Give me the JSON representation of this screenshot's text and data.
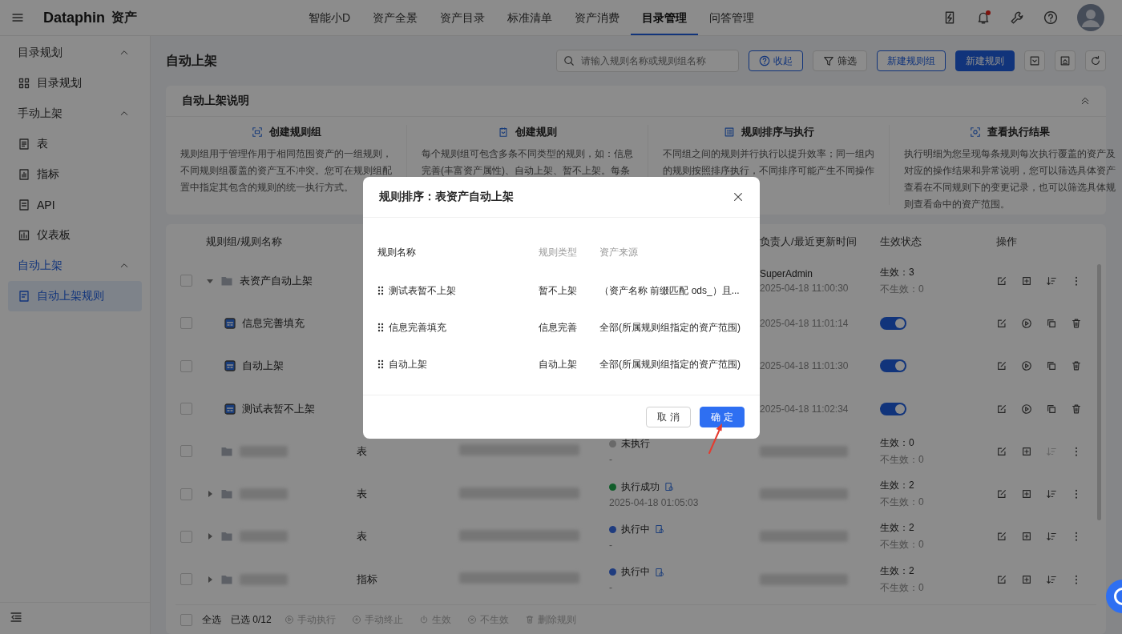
{
  "topbar": {
    "logo": "Dataphin",
    "product": "资产",
    "notification_dot": true,
    "nav": [
      {
        "label": "智能小D",
        "selected": false
      },
      {
        "label": "资产全景",
        "selected": false
      },
      {
        "label": "资产目录",
        "selected": false
      },
      {
        "label": "标准清单",
        "selected": false
      },
      {
        "label": "资产消费",
        "selected": false
      },
      {
        "label": "目录管理",
        "selected": true
      },
      {
        "label": "问答管理",
        "selected": false
      }
    ]
  },
  "sidebar": {
    "sections": [
      {
        "title": "目录规划",
        "expanded": true,
        "items": [
          {
            "label": "目录规划",
            "selected": false
          }
        ]
      },
      {
        "title": "手动上架",
        "expanded": true,
        "items": [
          {
            "label": "表",
            "selected": false
          },
          {
            "label": "指标",
            "selected": false
          },
          {
            "label": "API",
            "selected": false
          },
          {
            "label": "仪表板",
            "selected": false
          }
        ]
      },
      {
        "title": "自动上架",
        "expanded": true,
        "items": [
          {
            "label": "自动上架规则",
            "selected": true
          }
        ]
      }
    ]
  },
  "page": {
    "title": "自动上架",
    "search": {
      "placeholder": "请输入规则名称或规则组名称"
    },
    "buttons": [
      {
        "label": "收起",
        "kind": "collapse"
      },
      {
        "label": "筛选",
        "kind": "filter"
      },
      {
        "label": "新建规则组",
        "kind": "outline"
      },
      {
        "label": "新建规则",
        "kind": "primary"
      }
    ]
  },
  "intro": {
    "title": "自动上架说明",
    "expanded": true,
    "cards": [
      {
        "title": "创建规则组",
        "lines": [
          "规则组用于管理作用于相同范围资产的一组规则，",
          "不同规则组覆盖的资产互不冲突。您可在规则组配",
          "置中指定其包含的规则的统一执行方式。"
        ]
      },
      {
        "title": "创建规则",
        "lines": [
          "每个规则组可包含多条不同类型的规则，如：信息",
          "完善(丰富资产属性)、自动上架、暂不上架。每条"
        ]
      },
      {
        "title": "规则排序与执行",
        "lines": [
          "不同组之间的规则并行执行以提升效率；同一组内",
          "的规则按照排序执行，不同排序可能产生不同操作"
        ]
      },
      {
        "title": "查看执行结果",
        "lines": [
          "执行明细为您呈现每条规则每次执行覆盖的资产及",
          "对应的操作结果和异常说明，您可以筛选具体资产",
          "查看在不同规则下的变更记录，也可以筛选具体规",
          "则查看命中的资产范围。"
        ]
      }
    ]
  },
  "table": {
    "columns": {
      "name": "规则组/规则名称",
      "owner": "负责人/最近更新时间",
      "state": "生效状态",
      "actions": "操作"
    },
    "rows": [
      {
        "kind": "group",
        "checked": false,
        "expanded": true,
        "name": "表资产自动上架",
        "owner": "SuperAdmin",
        "time": "2025-04-18 11:00:30",
        "effective": "生效：3",
        "ineffective": "不生效：0",
        "sort_disabled": false
      },
      {
        "kind": "rule",
        "checked": false,
        "name": "信息完善填充",
        "time": "2025-04-18 11:01:14",
        "on": true
      },
      {
        "kind": "rule",
        "checked": false,
        "name": "自动上架",
        "time": "2025-04-18 11:01:30",
        "on": true
      },
      {
        "kind": "rule",
        "checked": false,
        "name": "测试表暂不上架",
        "time": "2025-04-18 11:02:34",
        "on": true
      },
      {
        "kind": "group",
        "checked": false,
        "type": "表",
        "status": {
          "kind": "idle",
          "label": "未执行",
          "time": "-"
        },
        "effective": "生效：0",
        "ineffective": "不生效：0",
        "sort_disabled": true
      },
      {
        "kind": "group",
        "checked": false,
        "expanded": false,
        "type": "表",
        "status": {
          "kind": "success",
          "label": "执行成功",
          "time": "2025-04-18 01:05:03"
        },
        "effective": "生效：2",
        "ineffective": "不生效：0",
        "sort_disabled": false
      },
      {
        "kind": "group",
        "checked": false,
        "expanded": false,
        "type": "表",
        "status": {
          "kind": "running",
          "label": "执行中",
          "time": "-"
        },
        "effective": "生效：2",
        "ineffective": "不生效：0",
        "sort_disabled": false
      },
      {
        "kind": "group",
        "checked": false,
        "expanded": false,
        "type": "指标",
        "status": {
          "kind": "running",
          "label": "执行中",
          "time": "-"
        },
        "effective": "生效：2",
        "ineffective": "不生效：0",
        "sort_disabled": false
      }
    ]
  },
  "footer": {
    "select_all": "全选",
    "select_all_checked": false,
    "selected_count": "已选 0/12",
    "actions": [
      {
        "label": "手动执行"
      },
      {
        "label": "手动终止"
      },
      {
        "label": "生效"
      },
      {
        "label": "不生效"
      },
      {
        "label": "删除规则"
      }
    ]
  },
  "modal": {
    "title": "规则排序：表资产自动上架",
    "columns": [
      "规则名称",
      "规则类型",
      "资产来源"
    ],
    "rows": [
      {
        "name": "测试表暂不上架",
        "type": "暂不上架",
        "source": "（资产名称 前缀匹配 ods_）且..."
      },
      {
        "name": "信息完善填充",
        "type": "信息完善",
        "source": "全部(所属规则组指定的资产范围)"
      },
      {
        "name": "自动上架",
        "type": "自动上架",
        "source": "全部(所属规则组指定的资产范围)"
      }
    ],
    "cancel": "取 消",
    "ok": "确 定"
  }
}
